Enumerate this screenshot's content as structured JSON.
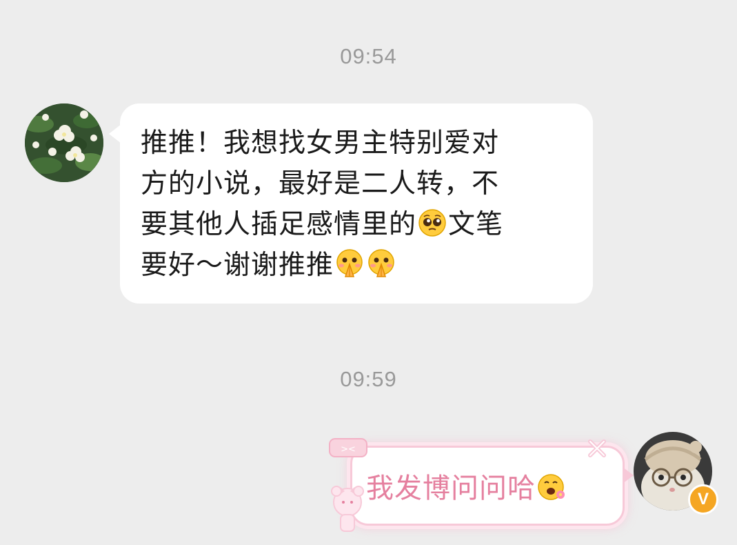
{
  "chat": {
    "timestamp_1": "09:54",
    "timestamp_2": "09:59",
    "incoming": {
      "line_1": "推推！我想找女男主特别爱对",
      "line_2": "方的小说，最好是二人转，不",
      "line_3a": "要其他人插足感情里的",
      "line_3b": "文笔",
      "line_4": "要好～谢谢推推",
      "emojis": [
        "pleading-face-emoji",
        "praying-hands-emoji",
        "praying-hands-emoji"
      ]
    },
    "outgoing": {
      "text": "我发博问问哈",
      "emoji": "happy-flower-emoji",
      "sticker_tag": "><",
      "verified_badge": "V"
    }
  },
  "colors": {
    "background": "#ededed",
    "incoming_bubble": "#ffffff",
    "outgoing_text": "#e5809f",
    "outgoing_border": "#f7c9d8",
    "badge": "#f5a623"
  }
}
